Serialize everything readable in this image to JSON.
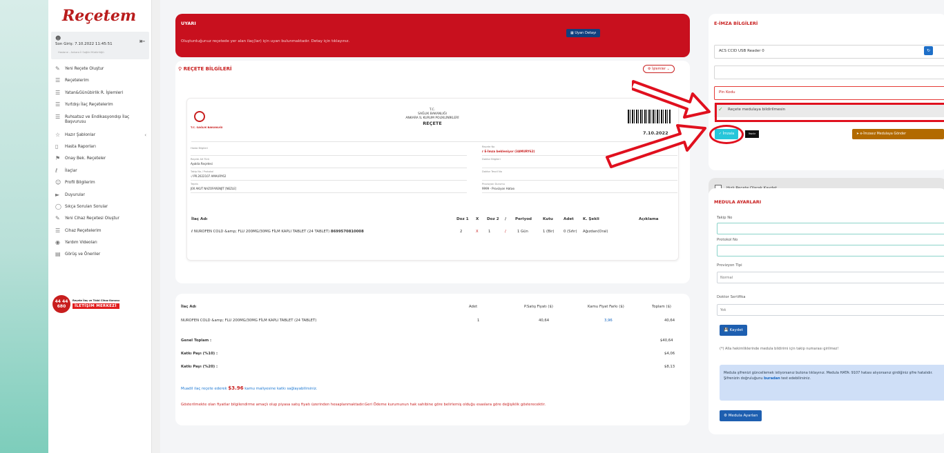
{
  "app": {
    "logo": "Reçetem"
  },
  "user": {
    "login_text": "Son Giriş: 7.10.2022 11:45:51",
    "org_text": "Hastane - Ankara İl Sağlık Müdürlüğü"
  },
  "sidebar": {
    "items": [
      {
        "label": "Yeni Reçete Oluştur",
        "icon": "edit-icon"
      },
      {
        "label": "Reçetelerim",
        "icon": "list-icon"
      },
      {
        "label": "Yatan&Günübirlik R. İşlemleri",
        "icon": "list-icon"
      },
      {
        "label": "Yurtdışı İlaç Reçetelerim",
        "icon": "list-icon"
      },
      {
        "label": "Ruhsatsız ve Endikasyondışı İlaç Başvurusu",
        "icon": "list-icon"
      },
      {
        "label": "Hazır Şablonlar",
        "icon": "star-icon"
      },
      {
        "label": "Hasta Raporları",
        "icon": "document-icon"
      },
      {
        "label": "Onay Bek. Reçeteler",
        "icon": "flag-icon"
      },
      {
        "label": "İlaçlar",
        "icon": "pill-icon"
      },
      {
        "label": "Profil Bilgilerim",
        "icon": "user-icon"
      },
      {
        "label": "Duyurular",
        "icon": "megaphone-icon"
      },
      {
        "label": "Sıkça Sorulan Sorular",
        "icon": "help-icon"
      },
      {
        "label": "Yeni Cihaz Reçetesi Oluştur",
        "icon": "edit-icon"
      },
      {
        "label": "Cihaz Reçetelerim",
        "icon": "list-icon"
      },
      {
        "label": "Yardım Videoları",
        "icon": "video-icon"
      },
      {
        "label": "Görüş ve Öneriler",
        "icon": "chat-icon"
      }
    ]
  },
  "callcenter": {
    "number_top": "44 44",
    "number_bottom": "680",
    "line1": "Reçete İlaç ve Tıbbi Cihaz Konusu",
    "line2": "İLETİŞİM MERKEZİ"
  },
  "warning": {
    "title": "UYARI",
    "text": "Oluşturduğunuz reçetede yer alan ilaç(lar) için uyarı bulunmaktadır. Detay için tıklayınız.",
    "button": "Uyarı Detayı"
  },
  "recete": {
    "title": "REÇETE BİLGİLERİ",
    "actions_label": "İşlemler",
    "header": {
      "tc": "T.C.",
      "ministry": "SAĞLIK BAKANLIĞI",
      "org": "ANKARA İL KURUM POLİKLİNİKLERİ",
      "doc_title": "REÇETE",
      "date": "7.10.2022",
      "logo_text": "T.C. SAĞLIK BAKANLIĞI"
    },
    "left_fields": [
      {
        "label": "Hasta Bilgileri",
        "value": ""
      },
      {
        "label": "Reçete Alt Türü",
        "value": "Ayakta Reçetesi"
      },
      {
        "label": "Takip No / Protokol",
        "value": "-/ PR.2022107 AMAURY62"
      },
      {
        "label": "Teşhis",
        "value": "J00 AKUT NAZOFARENJİT [NEZLE]"
      }
    ],
    "right_fields": [
      {
        "label": "Reçete No",
        "value": "E-İmza bekleniyor (3AMURY62)"
      },
      {
        "label": "Doktor Bilgileri",
        "value": ""
      },
      {
        "label": "Doktor Tescil No",
        "value": ""
      },
      {
        "label": "Provizyon Durumu",
        "value": "9999 - Provizyon Hatası"
      }
    ],
    "table_headers": [
      "İlaç Adı",
      "Doz 1",
      "X",
      "Doz 2",
      "/",
      "Periyod",
      "Kutu",
      "Adet",
      "K. Şekli",
      "Açıklama"
    ],
    "drug_row": {
      "name": "NUROFEN COLD &amp; FLU 200MG/30MG FİLM KAPLI TABLET (24 TABLET)",
      "barcode": "8699570810008",
      "doz1": "2",
      "x": "X",
      "doz2": "1",
      "slash": "/",
      "periyod": "1 Gün",
      "kutu": "1 (Bir)",
      "adet": "0 (Sıfır)",
      "sekli": "Ağızdan(Oral)"
    }
  },
  "ozet": {
    "headers": [
      "İlaç Adı",
      "Adet",
      "P.Satış Fiyatı ($)",
      "Kamu Fiyat Farkı ($)",
      "Toplam ($)"
    ],
    "row": {
      "name": "NUROFEN COLD &amp; FLU 200MG/30MG FİLM KAPLI TABLET (24 TABLET)",
      "adet": "1",
      "psf": "40,64",
      "kff": "3,96",
      "total": "40,64"
    },
    "totals": [
      {
        "label": "Genel Toplam :",
        "value": "$40,64"
      },
      {
        "label": "Katkı Payı (%10) :",
        "value": "$4,06"
      },
      {
        "label": "Katkı Payı (%20) :",
        "value": "$8,13"
      }
    ],
    "note1_pre": "Muadil ilaç reçete ederek ",
    "note1_amount": "$3.96",
    "note1_post": " kamu maliyesine katkı sağlayabilirsiniz.",
    "note2": "Gösterilmekte olan fiyatlar bilgilendirme amaçlı olup piyasa satış fiyatı üzerinden hesaplanmaktadır.Geri Ödeme kurumunun hak sahibine göre belirlemiş olduğu esaslara göre değişiklik gösterecektir."
  },
  "eimza": {
    "title": "E-İMZA BİLGİLERİ",
    "reader": "ACS CCID USB Reader 0",
    "pin_placeholder": "Pin Kodu",
    "medula_check": "Reçete medulaya bildirilmesin",
    "sign_button": "İmzala",
    "print_button": "Yazdır",
    "send_button": "e-İmzasız Medulaya Gönder"
  },
  "hizli": {
    "label": "Hızlı Reçete Olarak Kaydet"
  },
  "medula": {
    "title": "MEDULA AYARLARI",
    "takip_label": "Takip No",
    "protokol_label": "Protokol No",
    "provizyon_label": "Provizyon Tipi",
    "provizyon_value": "Normal",
    "sertifika_label": "Doktor Sertifika",
    "sertifika_value": "Yok",
    "save_button": "Kaydet",
    "note": "(*) Alla hekimliklerinde medula bildirimi için takip numarası girilmez!",
    "info_pre": "Medula şifrenizi güncellemek istiyorsanız butona tıklayınız. Medula HATA: 9107 hatası alıyorsanız girdiğiniz şifre hatalıdır. Şifrenizin doğruluğunu ",
    "info_link": "buradan",
    "info_post": " test edebilirsiniz.",
    "settings_button": "Medula Ayarları"
  },
  "colors": {
    "brand_red": "#c8101e",
    "annotation_red": "#e0101e",
    "primary_blue": "#1e5fb0",
    "teal": "#26c6da"
  }
}
